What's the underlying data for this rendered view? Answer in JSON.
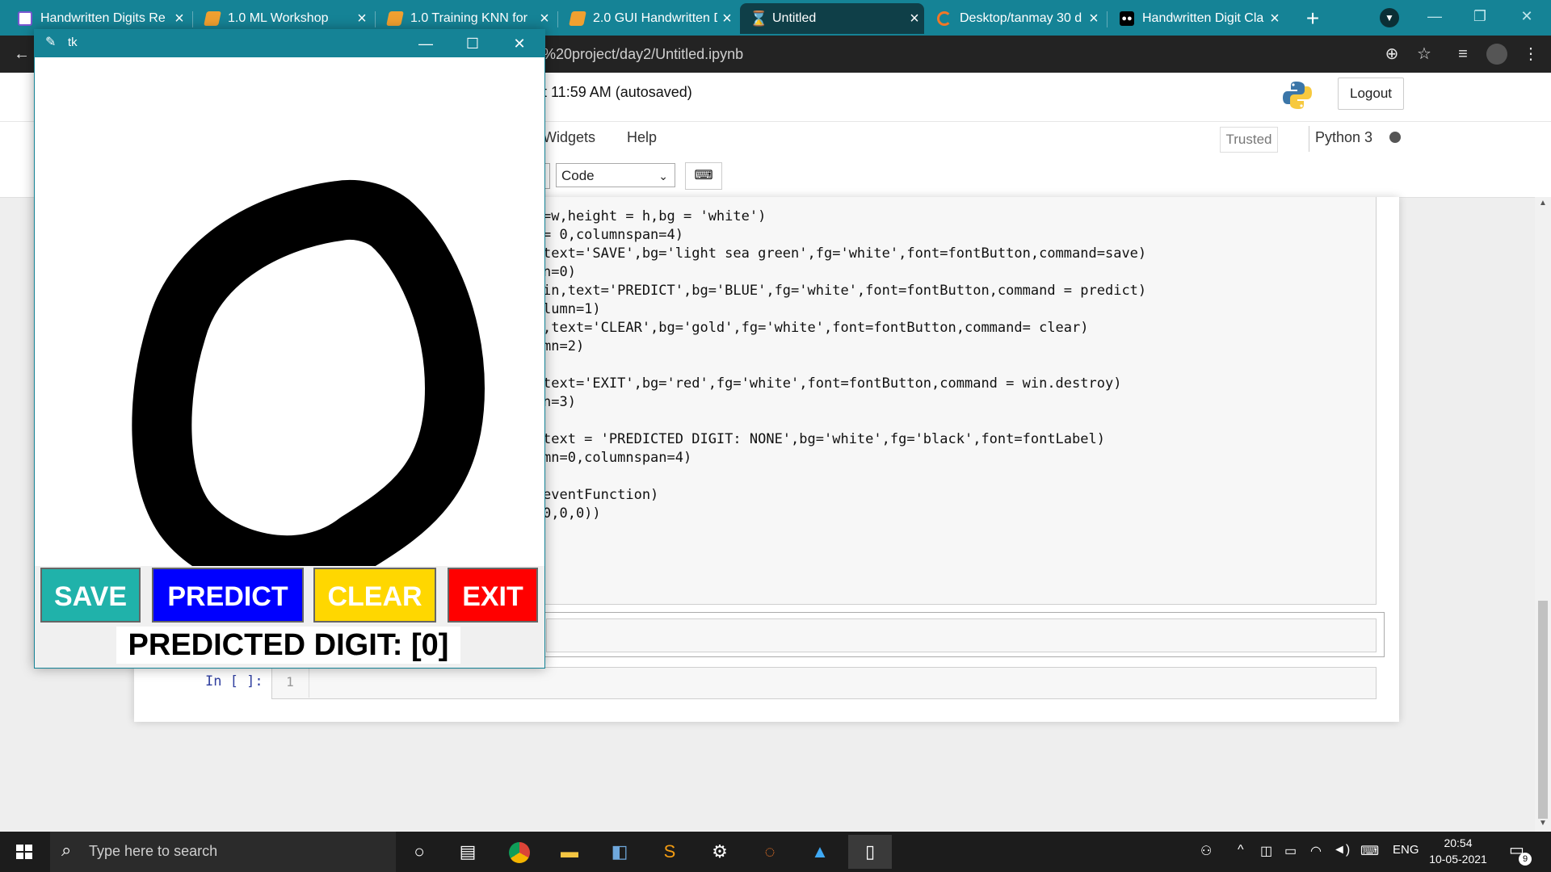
{
  "browser": {
    "tabs": [
      {
        "title": "Handwritten Digits Re",
        "active": false
      },
      {
        "title": "1.0 ML Workshop",
        "active": false
      },
      {
        "title": "1.0 Training KNN for ",
        "active": false
      },
      {
        "title": "2.0 GUI Handwritten D",
        "active": false
      },
      {
        "title": "Untitled",
        "active": true
      },
      {
        "title": "Desktop/tanmay 30 d",
        "active": false
      },
      {
        "title": "Handwritten Digit Cla",
        "active": false
      }
    ],
    "new_tab": "+",
    "url": "%20project/day2/Untitled.ipynb",
    "accent_color": "#158396"
  },
  "jupyter": {
    "save_status": "t 11:59 AM   (autosaved)",
    "logout_label": "Logout",
    "menu": [
      "Widgets",
      "Help"
    ],
    "trusted_label": "Trusted",
    "kernel_label": "Python 3",
    "cell_type": "Code",
    "code_lines": [
      "=w,height = h,bg = 'white')",
      "= 0,columnspan=4)",
      "text='SAVE',bg='light sea green',fg='white',font=fontButton,command=save)",
      "n=0)",
      "in,text='PREDICT',bg='BLUE',fg='white',font=fontButton,command = predict)",
      "lumn=1)",
      ",text='CLEAR',bg='gold',fg='white',font=fontButton,command= clear)",
      "mn=2)",
      "",
      "text='EXIT',bg='red',fg='white',font=fontButton,command = win.destroy)",
      "n=3)",
      "",
      "text = 'PREDICTED DIGIT: NONE',bg='white',fg='black',font=fontLabel)",
      "mn=0,columnspan=4)",
      "",
      "eventFunction)",
      "0,0,0))"
    ],
    "empty_prompt": "In [ ]:",
    "line_number": "1"
  },
  "tk_window": {
    "title": "tk",
    "buttons": {
      "save": {
        "label": "SAVE",
        "color": "#20b2aa"
      },
      "predict": {
        "label": "PREDICT",
        "color": "#0000ff"
      },
      "clear": {
        "label": "CLEAR",
        "color": "#ffd700"
      },
      "exit": {
        "label": "EXIT",
        "color": "#ff0000"
      }
    },
    "predicted_label": "PREDICTED DIGIT: [0]"
  },
  "taskbar": {
    "search_placeholder": "Type here to search",
    "language": "ENG",
    "time": "20:54",
    "date": "10-05-2021",
    "notification_count": "9"
  }
}
